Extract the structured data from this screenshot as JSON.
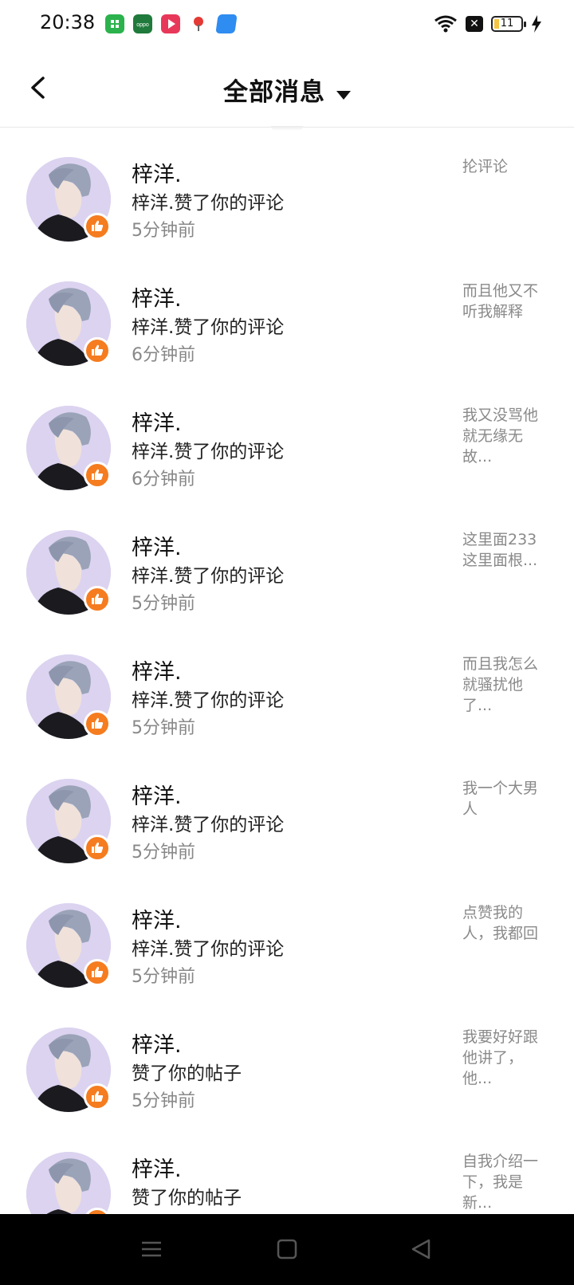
{
  "status_bar": {
    "time": "20:38",
    "battery": "11",
    "app_icons": [
      {
        "name": "green-app-icon",
        "color": "#2bb24c"
      },
      {
        "name": "oppo-app-icon",
        "color": "#1f7a3b"
      },
      {
        "name": "video-app-icon",
        "color": "#e8385a"
      },
      {
        "name": "map-pin-app-icon",
        "color": "#e53935"
      },
      {
        "name": "blue-app-icon",
        "color": "#2f8cf0"
      }
    ]
  },
  "header": {
    "title": "全部消息"
  },
  "colors": {
    "like_badge": "#f57c1f",
    "avatar_bg": "#dcd3f0"
  },
  "messages": [
    {
      "name": "梓洋.",
      "action": "梓洋.赞了你的评论",
      "time": "5分钟前",
      "preview": "抡评论"
    },
    {
      "name": "梓洋.",
      "action": "梓洋.赞了你的评论",
      "time": "6分钟前",
      "preview": "而且他又不听我解释"
    },
    {
      "name": "梓洋.",
      "action": "梓洋.赞了你的评论",
      "time": "6分钟前",
      "preview": "我又没骂他就无缘无故..."
    },
    {
      "name": "梓洋.",
      "action": "梓洋.赞了你的评论",
      "time": "5分钟前",
      "preview": "这里面233这里面根..."
    },
    {
      "name": "梓洋.",
      "action": "梓洋.赞了你的评论",
      "time": "5分钟前",
      "preview": "而且我怎么就骚扰他了..."
    },
    {
      "name": "梓洋.",
      "action": "梓洋.赞了你的评论",
      "time": "5分钟前",
      "preview": "我一个大男人"
    },
    {
      "name": "梓洋.",
      "action": "梓洋.赞了你的评论",
      "time": "5分钟前",
      "preview": "点赞我的人，我都回"
    },
    {
      "name": "梓洋.",
      "action": "赞了你的帖子",
      "time": "5分钟前",
      "preview": "我要好好跟他讲了，他..."
    },
    {
      "name": "梓洋.",
      "action": "赞了你的帖子",
      "time": "",
      "preview": "自我介绍一下，我是新..."
    }
  ]
}
